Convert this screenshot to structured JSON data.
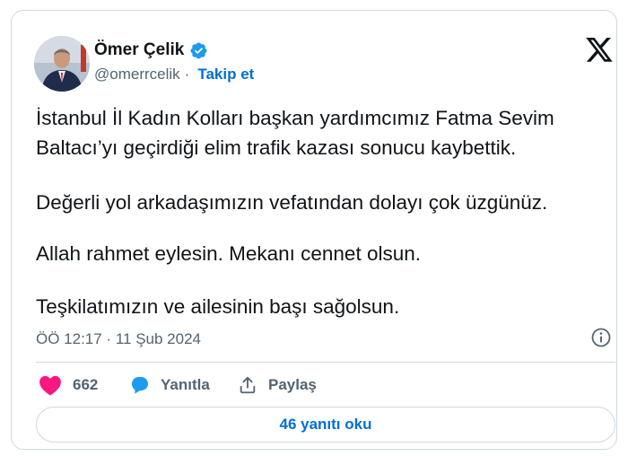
{
  "author": {
    "display_name": "Ömer Çelik",
    "handle": "@omerrcelik",
    "separator": "·",
    "follow_label": "Takip et",
    "verified": true
  },
  "tweet": {
    "paragraphs": [
      "İstanbul İl Kadın Kolları başkan yardımcımız Fatma Sevim Baltacı’yı geçirdiği elim trafik kazası sonucu kaybettik.",
      "Değerli yol arkadaşımızın vefatından dolayı çok üzgünüz.",
      "Allah rahmet eylesin. Mekanı cennet olsun.",
      "Teşkilatımızın ve ailesinin başı sağolsun."
    ],
    "timestamp": "ÖÖ 12:17 · 11 Şub 2024"
  },
  "actions": {
    "like_count": "662",
    "reply_label": "Yanıtla",
    "share_label": "Paylaş"
  },
  "replies_button": "46 yanıtı oku",
  "icons": {
    "logo": "x-logo-icon",
    "verified": "verified-badge-icon",
    "info": "info-icon",
    "like": "heart-icon",
    "reply": "reply-bubble-icon",
    "share": "share-upload-icon"
  },
  "colors": {
    "text": "#0f1419",
    "secondary": "#536471",
    "link": "#006fd6",
    "verified": "#1d9bf0",
    "like": "#f91880",
    "border": "#cfd9de"
  }
}
